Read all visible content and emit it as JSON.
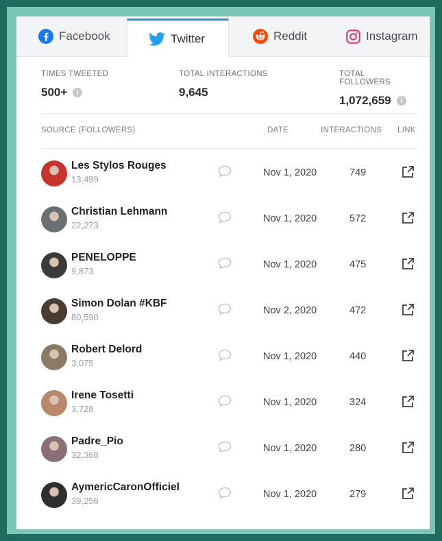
{
  "tabs": [
    {
      "label": "Facebook",
      "icon": "facebook-icon",
      "active": false
    },
    {
      "label": "Twitter",
      "icon": "twitter-icon",
      "active": true
    },
    {
      "label": "Reddit",
      "icon": "reddit-icon",
      "active": false
    },
    {
      "label": "Instagram",
      "icon": "instagram-icon",
      "active": false
    }
  ],
  "stats": {
    "times_tweeted": {
      "label": "TIMES TWEETED",
      "value": "500+"
    },
    "total_interactions": {
      "label": "TOTAL INTERACTIONS",
      "value": "9,645"
    },
    "total_followers": {
      "label": "TOTAL FOLLOWERS",
      "value": "1,072,659"
    }
  },
  "table": {
    "headers": {
      "source": "SOURCE (FOLLOWERS)",
      "date": "DATE",
      "interactions": "INTERACTIONS",
      "link": "LINK"
    },
    "rows": [
      {
        "name": "Les Stylos Rouges",
        "followers": "13,499",
        "date": "Nov 1, 2020",
        "interactions": "749",
        "avatar_color": "#c8342c"
      },
      {
        "name": "Christian Lehmann",
        "followers": "22,273",
        "date": "Nov 1, 2020",
        "interactions": "572",
        "avatar_color": "#6b6f73"
      },
      {
        "name": "PENELOPPE",
        "followers": "9,873",
        "date": "Nov 1, 2020",
        "interactions": "475",
        "avatar_color": "#3a3a3a"
      },
      {
        "name": "Simon Dolan #KBF",
        "followers": "80,590",
        "date": "Nov 2, 2020",
        "interactions": "472",
        "avatar_color": "#4a3b33"
      },
      {
        "name": "Robert Delord",
        "followers": "3,075",
        "date": "Nov 1, 2020",
        "interactions": "440",
        "avatar_color": "#8a7a66"
      },
      {
        "name": "Irene Tosetti",
        "followers": "3,728",
        "date": "Nov 1, 2020",
        "interactions": "324",
        "avatar_color": "#b9876a"
      },
      {
        "name": "Padre_Pio",
        "followers": "32,368",
        "date": "Nov 1, 2020",
        "interactions": "280",
        "avatar_color": "#8a6f77"
      },
      {
        "name": "AymericCaronOfficiel",
        "followers": "39,256",
        "date": "Nov 1, 2020",
        "interactions": "279",
        "avatar_color": "#2f2f2f"
      }
    ]
  },
  "colors": {
    "accent": "#2a8ee0",
    "facebook": "#1877f2",
    "twitter": "#1da1f2",
    "reddit": "#ff4500",
    "instagram": "#e1306c"
  }
}
